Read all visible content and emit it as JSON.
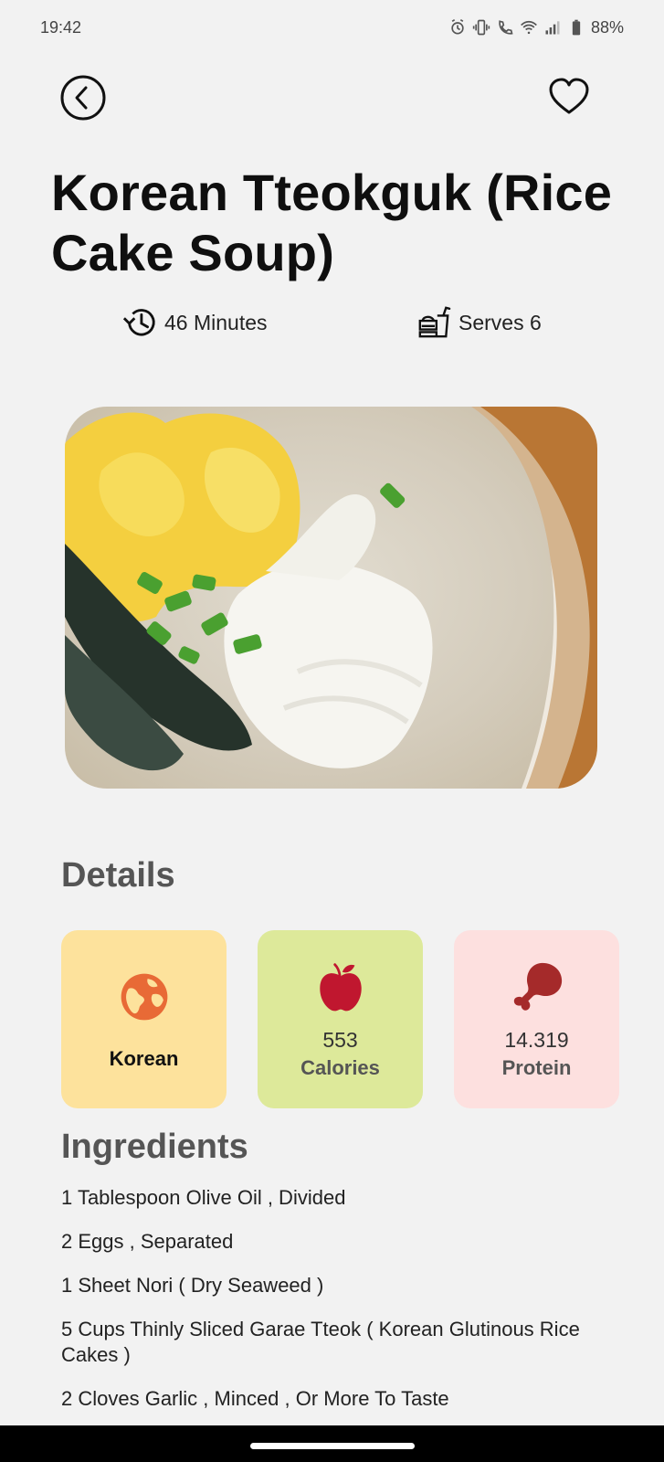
{
  "status_bar": {
    "time": "19:42",
    "battery": "88%",
    "icons": [
      "alarm-icon",
      "vibrate-icon",
      "wifi-calling-icon",
      "wifi-icon",
      "signal-icon",
      "battery-icon"
    ]
  },
  "header": {
    "back_icon": "chevron-left-icon",
    "favorite_icon": "heart-outline-icon"
  },
  "recipe": {
    "title": "Korean Tteokguk (Rice Cake Soup)",
    "time": "46 Minutes",
    "serves": "Serves 6",
    "time_icon": "history-icon",
    "serves_icon": "fast-food-icon",
    "image_alt": "Tteokguk rice cake soup in an earthenware bowl"
  },
  "details": {
    "title": "Details",
    "cuisine": {
      "label": "Korean",
      "icon": "globe-icon",
      "color": "#e86a36"
    },
    "calories": {
      "value": "553",
      "label": "Calories",
      "icon": "apple-icon",
      "color": "#c0172f"
    },
    "protein": {
      "value": "14.319",
      "label": "Protein",
      "icon": "drumstick-icon",
      "color": "#a52a2a"
    }
  },
  "ingredients": {
    "title": "Ingredients",
    "items": [
      "1 Tablespoon Olive Oil , Divided",
      "2 Eggs , Separated",
      "1 Sheet Nori ( Dry Seaweed )",
      "5 Cups Thinly Sliced Garae Tteok ( Korean Glutinous Rice Cakes )",
      "2 Cloves Garlic , Minced , Or More To Taste"
    ]
  },
  "colors": {
    "background": "#f2f2f2",
    "cuisine_card": "#fde29c",
    "calories_card": "#dde99a",
    "protein_card": "#fde0df"
  }
}
